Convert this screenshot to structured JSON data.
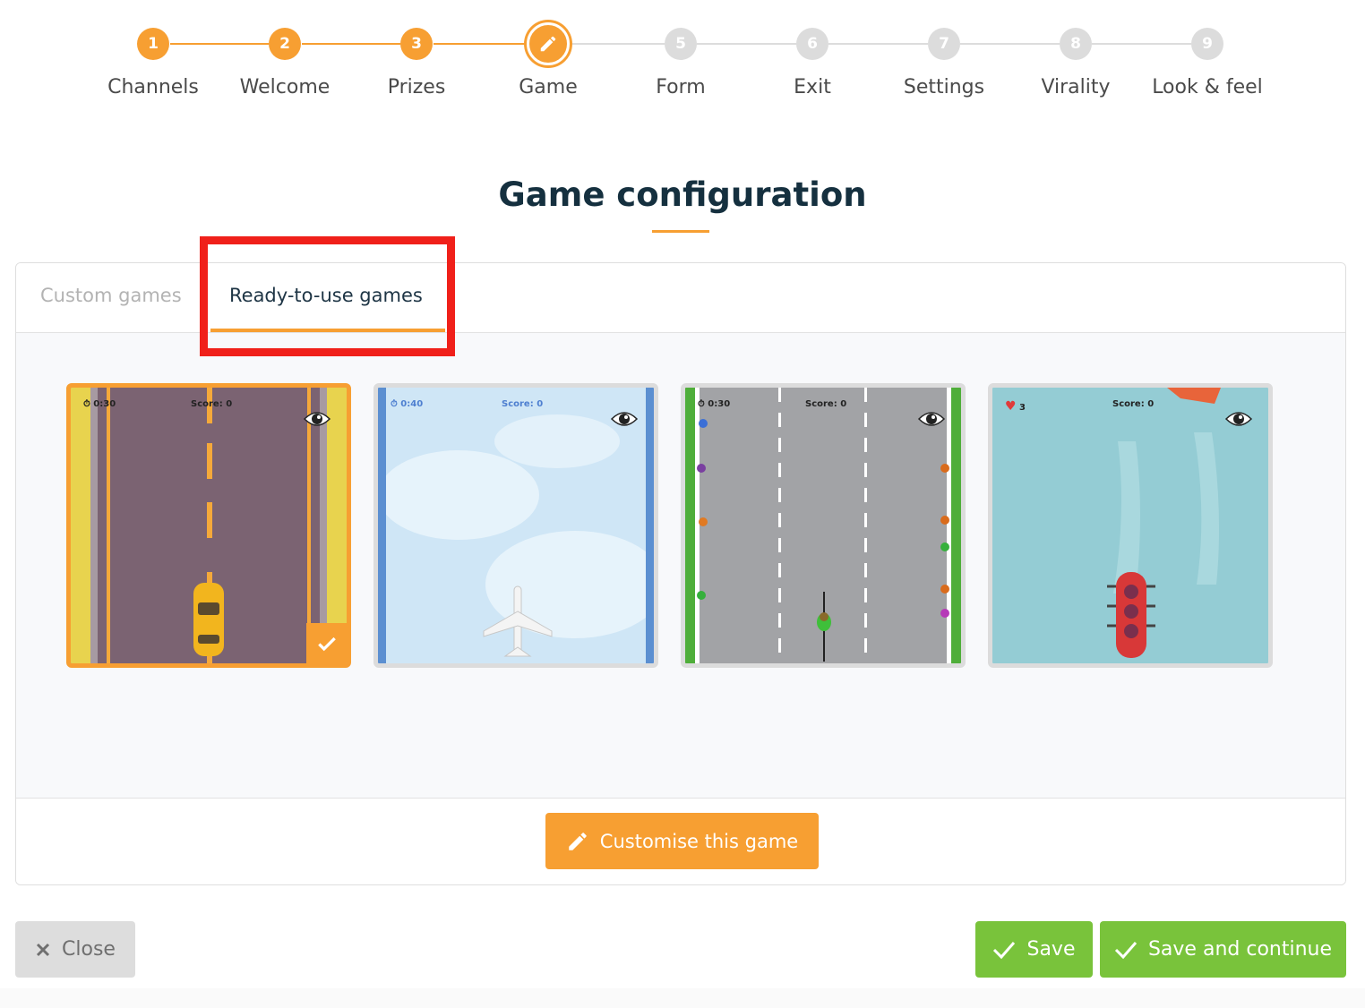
{
  "stepper": {
    "steps": [
      {
        "number": "1",
        "label": "Channels",
        "state": "done"
      },
      {
        "number": "2",
        "label": "Welcome",
        "state": "done"
      },
      {
        "number": "3",
        "label": "Prizes",
        "state": "done"
      },
      {
        "number": "",
        "label": "Game",
        "state": "current"
      },
      {
        "number": "5",
        "label": "Form",
        "state": "todo"
      },
      {
        "number": "6",
        "label": "Exit",
        "state": "todo"
      },
      {
        "number": "7",
        "label": "Settings",
        "state": "todo"
      },
      {
        "number": "8",
        "label": "Virality",
        "state": "todo"
      },
      {
        "number": "9",
        "label": "Look & feel",
        "state": "todo"
      }
    ]
  },
  "page": {
    "title": "Game configuration"
  },
  "tabs": {
    "custom": "Custom games",
    "ready": "Ready-to-use games"
  },
  "games": [
    {
      "hud_left": "0:30",
      "hud_score": "Score: 0",
      "theme": "taxi-road",
      "selected": true
    },
    {
      "hud_left": "0:40",
      "hud_score": "Score: 0",
      "theme": "airplane-sky",
      "selected": false
    },
    {
      "hud_left": "0:30",
      "hud_score": "Score: 0",
      "theme": "bike-race",
      "selected": false
    },
    {
      "hud_left": "3",
      "hud_score": "Score: 0",
      "theme": "river-raft",
      "selected": false
    }
  ],
  "buttons": {
    "customise": "Customise this game",
    "close": "Close",
    "save": "Save",
    "save_continue": "Save and continue"
  },
  "colors": {
    "accent": "#f79f32",
    "success": "#79c33b",
    "highlight": "#f0201a"
  }
}
